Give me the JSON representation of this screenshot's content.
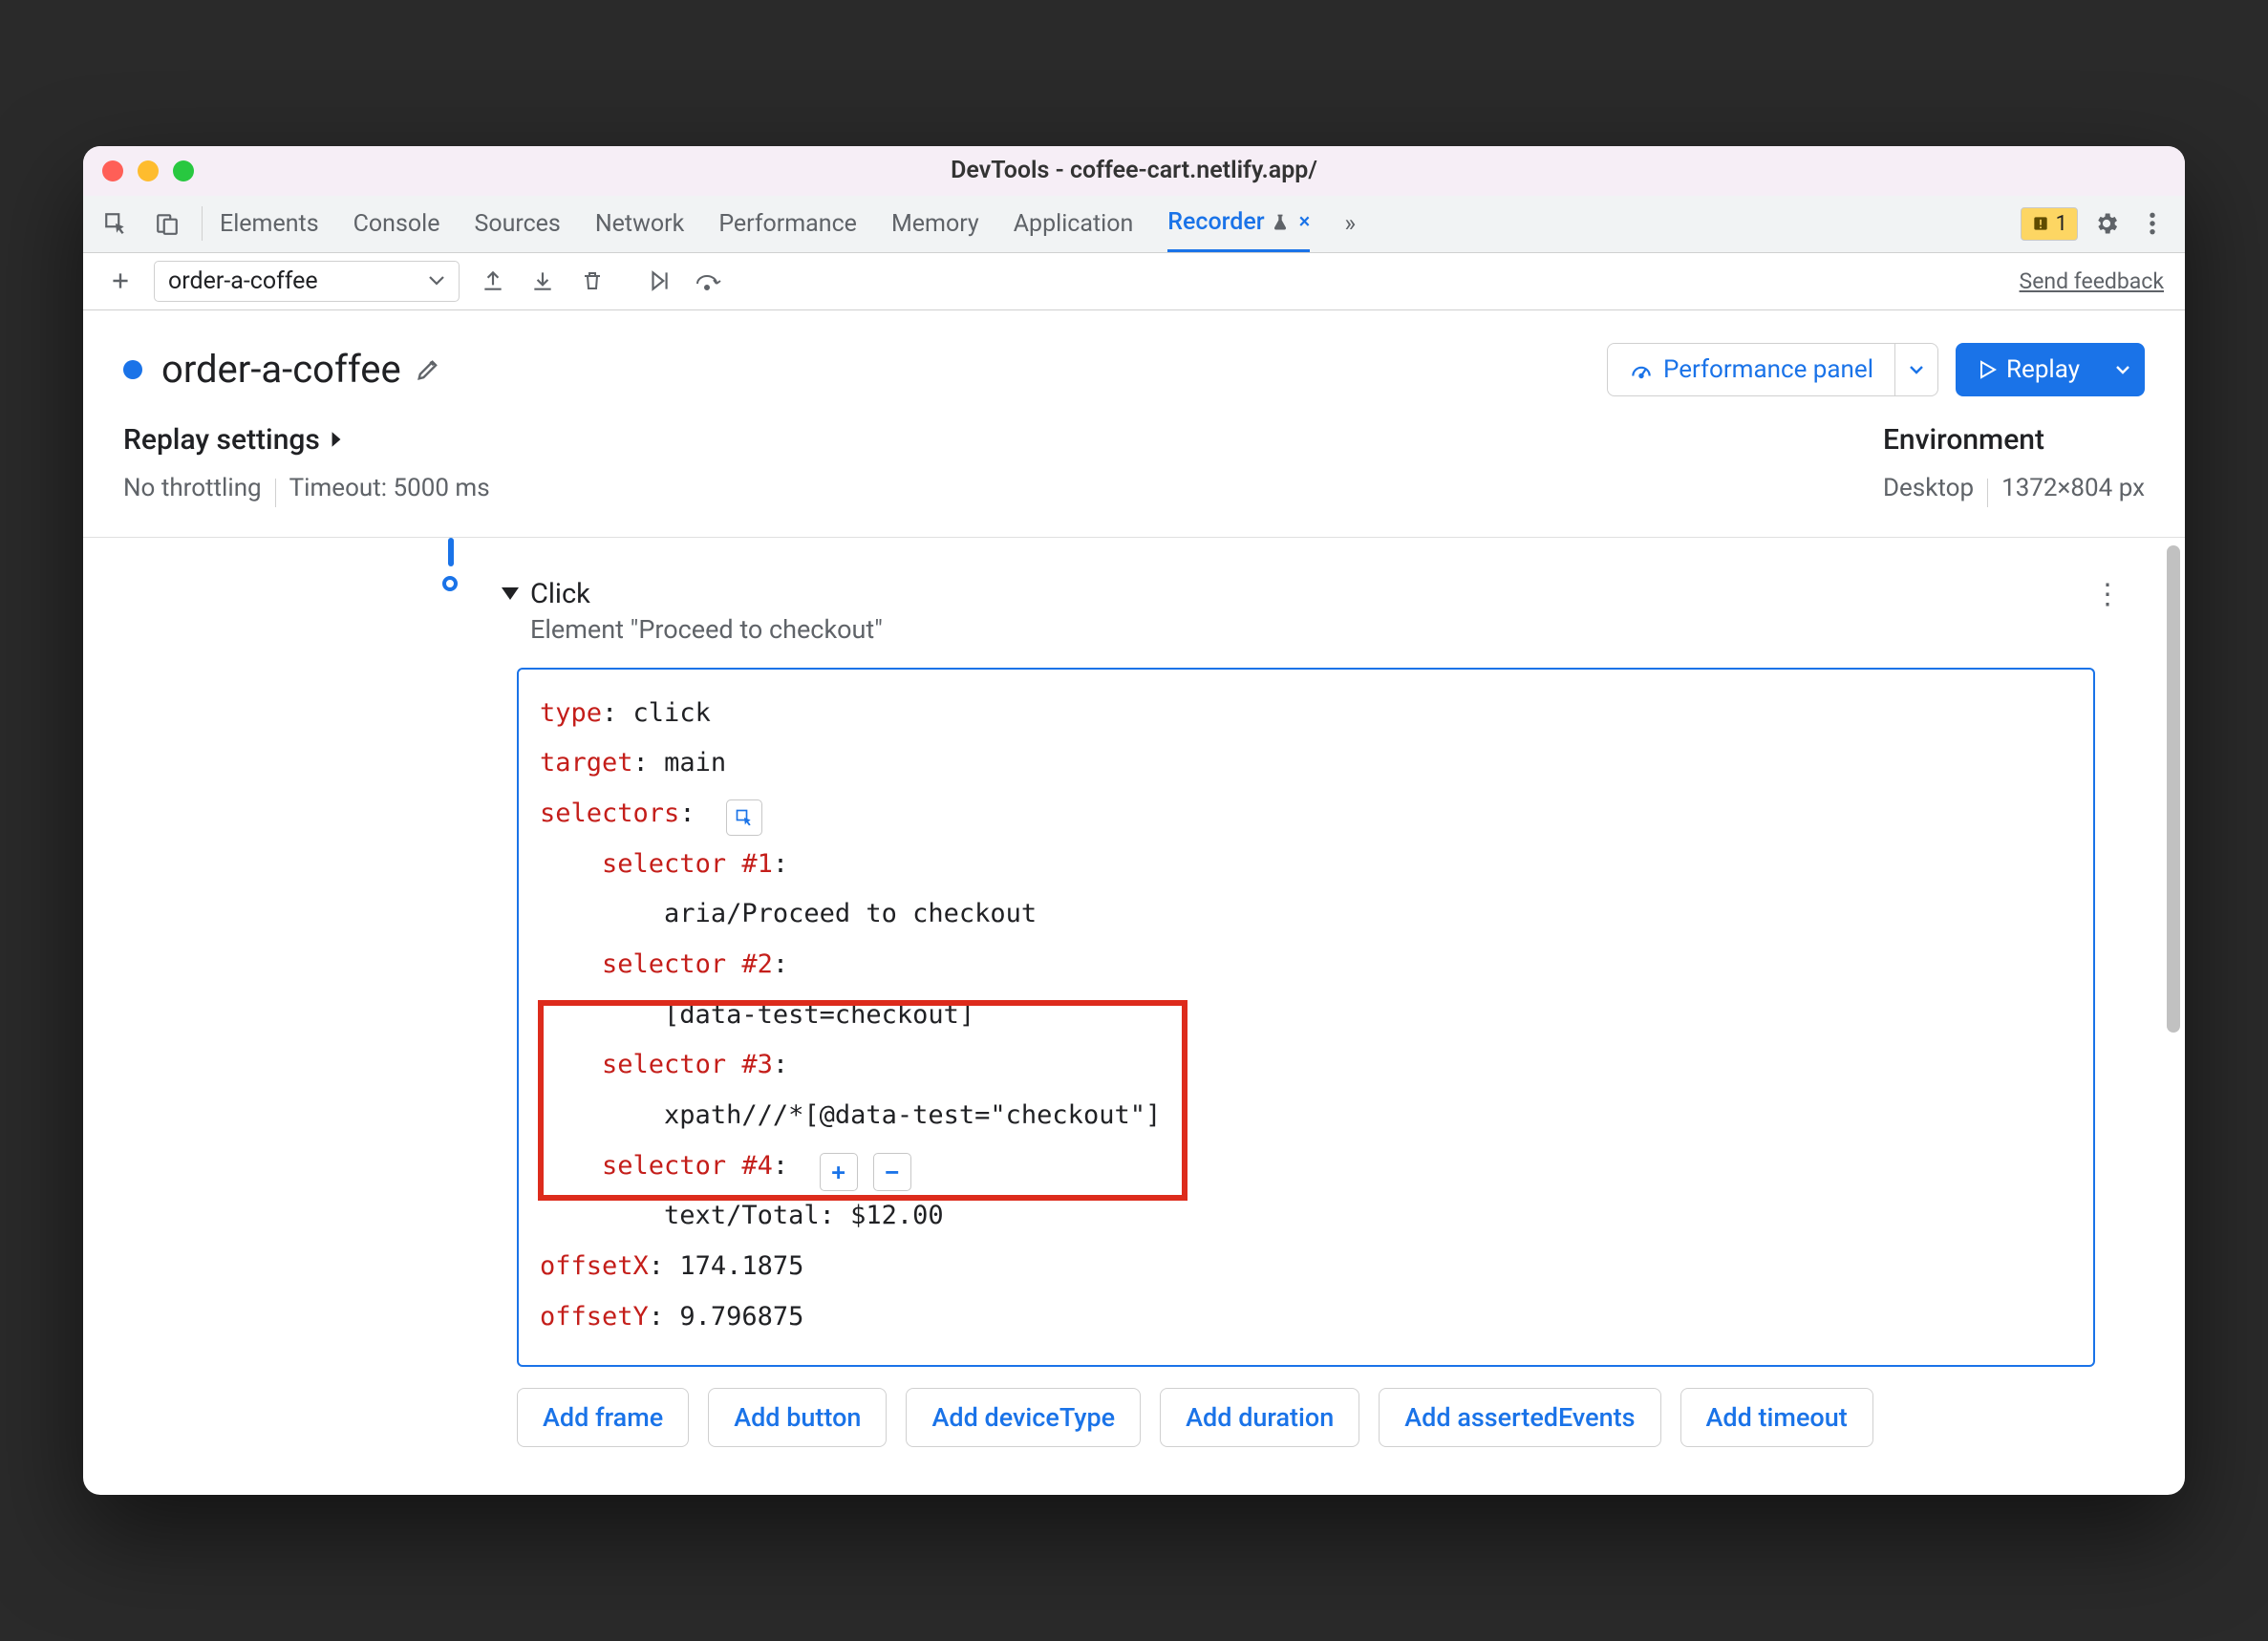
{
  "window": {
    "title": "DevTools - coffee-cart.netlify.app/"
  },
  "tabs": {
    "items": [
      "Elements",
      "Console",
      "Sources",
      "Network",
      "Performance",
      "Memory",
      "Application",
      "Recorder"
    ],
    "activeIndex": 7,
    "moreGlyph": "»"
  },
  "issues": {
    "count": "1"
  },
  "toolbar": {
    "recordingName": "order-a-coffee",
    "feedback": "Send feedback"
  },
  "header": {
    "title": "order-a-coffee",
    "perfPanel": "Performance panel",
    "replay": "Replay"
  },
  "settingsLeft": {
    "title": "Replay settings",
    "throttle": "No throttling",
    "timeout": "Timeout: 5000 ms"
  },
  "settingsRight": {
    "title": "Environment",
    "device": "Desktop",
    "dims": "1372×804 px"
  },
  "step": {
    "title": "Click",
    "subtitle": "Element \"Proceed to checkout\"",
    "body": {
      "typeKey": "type",
      "typeVal": "click",
      "targetKey": "target",
      "targetVal": "main",
      "selectorsKey": "selectors",
      "sel1Key": "selector #1",
      "sel1Val": "aria/Proceed to checkout",
      "sel2Key": "selector #2",
      "sel2Val": "[data-test=checkout]",
      "sel3Key": "selector #3",
      "sel3Val": "xpath///*[@data-test=\"checkout\"]",
      "sel4Key": "selector #4",
      "sel4Val": "text/Total: $12.00",
      "offXKey": "offsetX",
      "offXVal": "174.1875",
      "offYKey": "offsetY",
      "offYVal": "9.796875"
    },
    "addButtons": [
      "Add frame",
      "Add button",
      "Add deviceType",
      "Add duration",
      "Add assertedEvents",
      "Add timeout"
    ]
  }
}
